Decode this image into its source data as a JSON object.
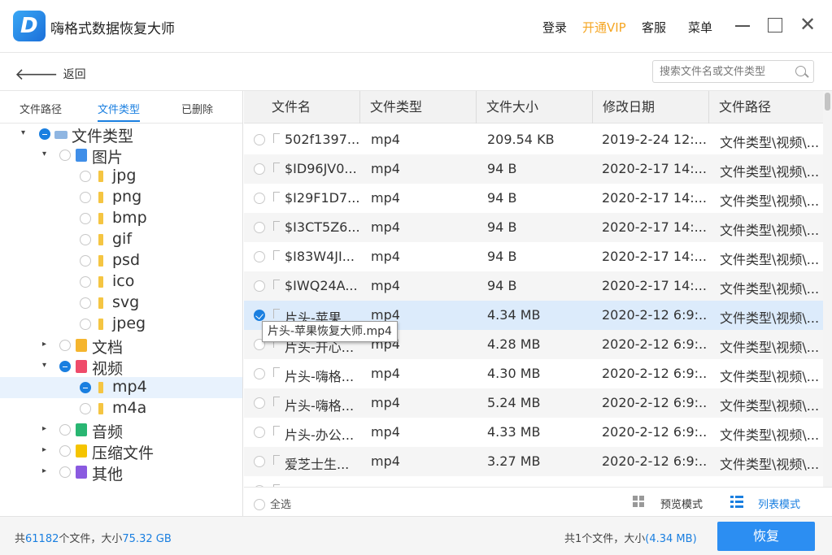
{
  "app": {
    "title": "嗨格式数据恢复大师",
    "logo_letter": "D",
    "login": "登录",
    "vip": "开通VIP",
    "service": "客服",
    "menu": "菜单",
    "close_glyph": "✕"
  },
  "nav": {
    "back_label": "返回",
    "back_glyph": "🡐",
    "search_placeholder": "搜索文件名或文件类型"
  },
  "left_tabs": [
    "文件路径",
    "文件类型",
    "已删除"
  ],
  "tree": [
    {
      "label": "文件类型",
      "icon": "drive",
      "caret": "▾",
      "state": "partial"
    },
    {
      "label": "图片",
      "icon": "img",
      "caret": "▾",
      "state": "none"
    },
    {
      "label": "jpg",
      "icon": "folder",
      "caret": "",
      "state": "none"
    },
    {
      "label": "png",
      "icon": "folder",
      "caret": "",
      "state": "none"
    },
    {
      "label": "bmp",
      "icon": "folder",
      "caret": "",
      "state": "none"
    },
    {
      "label": "gif",
      "icon": "folder",
      "caret": "",
      "state": "none"
    },
    {
      "label": "psd",
      "icon": "folder",
      "caret": "",
      "state": "none"
    },
    {
      "label": "ico",
      "icon": "folder",
      "caret": "",
      "state": "none"
    },
    {
      "label": "svg",
      "icon": "folder",
      "caret": "",
      "state": "none"
    },
    {
      "label": "jpeg",
      "icon": "folder",
      "caret": "",
      "state": "none"
    },
    {
      "label": "文档",
      "icon": "doc",
      "caret": "▸",
      "state": "none"
    },
    {
      "label": "视频",
      "icon": "vid",
      "caret": "▾",
      "state": "partial"
    },
    {
      "label": "mp4",
      "icon": "folder",
      "caret": "",
      "state": "partial"
    },
    {
      "label": "m4a",
      "icon": "folder",
      "caret": "",
      "state": "none"
    },
    {
      "label": "音频",
      "icon": "aud",
      "caret": "▸",
      "state": "none"
    },
    {
      "label": "压缩文件",
      "icon": "zip",
      "caret": "▸",
      "state": "none"
    },
    {
      "label": "其他",
      "icon": "other",
      "caret": "▸",
      "state": "none"
    }
  ],
  "columns": [
    "文件名",
    "文件类型",
    "文件大小",
    "修改日期",
    "文件路径"
  ],
  "rows": [
    {
      "name": "502f1397...",
      "type": "mp4",
      "size": "209.54 KB",
      "date": "2019-2-24 12:...",
      "path": "文件类型\\视频\\..."
    },
    {
      "name": "$ID96JV0...",
      "type": "mp4",
      "size": "94 B",
      "date": "2020-2-17 14:...",
      "path": "文件类型\\视频\\..."
    },
    {
      "name": "$I29F1D7...",
      "type": "mp4",
      "size": "94 B",
      "date": "2020-2-17 14:...",
      "path": "文件类型\\视频\\..."
    },
    {
      "name": "$I3CT5Z6...",
      "type": "mp4",
      "size": "94 B",
      "date": "2020-2-17 14:...",
      "path": "文件类型\\视频\\..."
    },
    {
      "name": "$I83W4JI...",
      "type": "mp4",
      "size": "94 B",
      "date": "2020-2-17 14:...",
      "path": "文件类型\\视频\\..."
    },
    {
      "name": "$IWQ24A...",
      "type": "mp4",
      "size": "94 B",
      "date": "2020-2-17 14:...",
      "path": "文件类型\\视频\\..."
    },
    {
      "name": "片头-苹果...",
      "type": "mp4",
      "size": "4.34 MB",
      "date": "2020-2-12 6:9:...",
      "path": "文件类型\\视频\\..."
    },
    {
      "name": "片头-开心...",
      "type": "mp4",
      "size": "4.28 MB",
      "date": "2020-2-12 6:9:...",
      "path": "文件类型\\视频\\..."
    },
    {
      "name": "片头-嗨格...",
      "type": "mp4",
      "size": "4.30 MB",
      "date": "2020-2-12 6:9:...",
      "path": "文件类型\\视频\\..."
    },
    {
      "name": "片头-嗨格...",
      "type": "mp4",
      "size": "5.24 MB",
      "date": "2020-2-12 6:9:...",
      "path": "文件类型\\视频\\..."
    },
    {
      "name": "片头-办公...",
      "type": "mp4",
      "size": "4.33 MB",
      "date": "2020-2-12 6:9:...",
      "path": "文件类型\\视频\\..."
    },
    {
      "name": "爱芝士生...",
      "type": "mp4",
      "size": "3.27 MB",
      "date": "2020-2-12 6:9:...",
      "path": "文件类型\\视频\\..."
    },
    {
      "name": "...",
      "type": "",
      "size": "",
      "date": "",
      "path": ""
    }
  ],
  "selected_row": 6,
  "tooltip": "片头-苹果恢复大师.mp4",
  "bottom": {
    "select_all": "全选",
    "preview_mode": "预览模式",
    "list_mode": "列表模式"
  },
  "footer": {
    "left_prefix": "共",
    "total_files": "61182",
    "left_mid": "个文件，大小",
    "total_size": "75.32 GB",
    "right_prefix": "共1个文件，大小",
    "selected_size": "(4.34 MB)",
    "recover": "恢复"
  },
  "colors": {
    "accent": "#1a7fe0",
    "vip": "#f5a623",
    "selected_row": "#dcebfb",
    "recover_button": "#2c8ef2"
  }
}
